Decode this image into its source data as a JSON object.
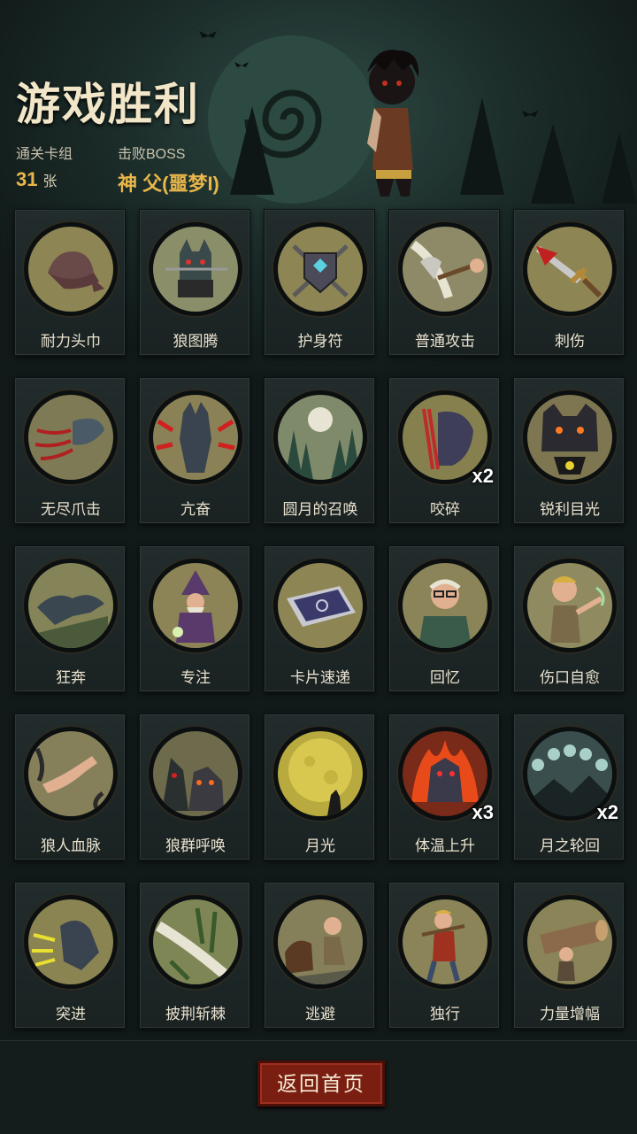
{
  "header": {
    "title": "游戏胜利",
    "deck_label": "通关卡组",
    "deck_count": "31",
    "deck_unit": "张",
    "boss_label": "击败BOSS",
    "boss_name": "神 父(噩梦I)"
  },
  "cards": [
    {
      "name": "耐力头巾",
      "icon": "bandana-icon",
      "mult": "",
      "bg": "#8e8555"
    },
    {
      "name": "狼图腾",
      "icon": "wolf-totem-icon",
      "mult": "",
      "bg": "#8a8f6a"
    },
    {
      "name": "护身符",
      "icon": "amulet-icon",
      "mult": "",
      "bg": "#8e8555"
    },
    {
      "name": "普通攻击",
      "icon": "axe-strike-icon",
      "mult": "",
      "bg": "#8e8a68"
    },
    {
      "name": "刺伤",
      "icon": "bloody-sword-icon",
      "mult": "",
      "bg": "#8e8555"
    },
    {
      "name": "无尽爪击",
      "icon": "claw-icon",
      "mult": "",
      "bg": "#7e7a55"
    },
    {
      "name": "亢奋",
      "icon": "werewolf-frenzy-icon",
      "mult": "",
      "bg": "#8a8156"
    },
    {
      "name": "圆月的召唤",
      "icon": "full-moon-forest-icon",
      "mult": "",
      "bg": "#7f8a6a"
    },
    {
      "name": "咬碎",
      "icon": "bite-icon",
      "mult": "x2",
      "bg": "#86804f"
    },
    {
      "name": "锐利目光",
      "icon": "glowing-eyes-icon",
      "mult": "",
      "bg": "#7d7650"
    },
    {
      "name": "狂奔",
      "icon": "running-wolf-icon",
      "mult": "",
      "bg": "#848458"
    },
    {
      "name": "专注",
      "icon": "wizard-icon",
      "mult": "",
      "bg": "#8c8456"
    },
    {
      "name": "卡片速递",
      "icon": "card-icon",
      "mult": "",
      "bg": "#8e8555"
    },
    {
      "name": "回忆",
      "icon": "old-man-icon",
      "mult": "",
      "bg": "#8a8458"
    },
    {
      "name": "伤口自愈",
      "icon": "boy-heal-icon",
      "mult": "",
      "bg": "#8f8a60"
    },
    {
      "name": "狼人血脉",
      "icon": "arm-icon",
      "mult": "",
      "bg": "#86805a"
    },
    {
      "name": "狼群呼唤",
      "icon": "wolf-pack-icon",
      "mult": "",
      "bg": "#6e6a4c"
    },
    {
      "name": "月光",
      "icon": "moonlight-icon",
      "mult": "",
      "bg": "#b8aa3e"
    },
    {
      "name": "体温上升",
      "icon": "burning-wolf-icon",
      "mult": "x3",
      "bg": "#7a2a18"
    },
    {
      "name": "月之轮回",
      "icon": "moon-phases-icon",
      "mult": "x2",
      "bg": "#3a4e4e"
    },
    {
      "name": "突进",
      "icon": "dash-icon",
      "mult": "",
      "bg": "#8a8452"
    },
    {
      "name": "披荆斩棘",
      "icon": "slash-thorns-icon",
      "mult": "",
      "bg": "#7e8656"
    },
    {
      "name": "逃避",
      "icon": "escape-icon",
      "mult": "",
      "bg": "#86805a"
    },
    {
      "name": "独行",
      "icon": "lone-walk-icon",
      "mult": "",
      "bg": "#8a8458"
    },
    {
      "name": "力量增幅",
      "icon": "log-lift-icon",
      "mult": "",
      "bg": "#8a8458"
    }
  ],
  "footer": {
    "home_button": "返回首页"
  },
  "colors": {
    "accent": "#e8b64a",
    "button": "#7a1e12",
    "title": "#f2e6c8"
  }
}
